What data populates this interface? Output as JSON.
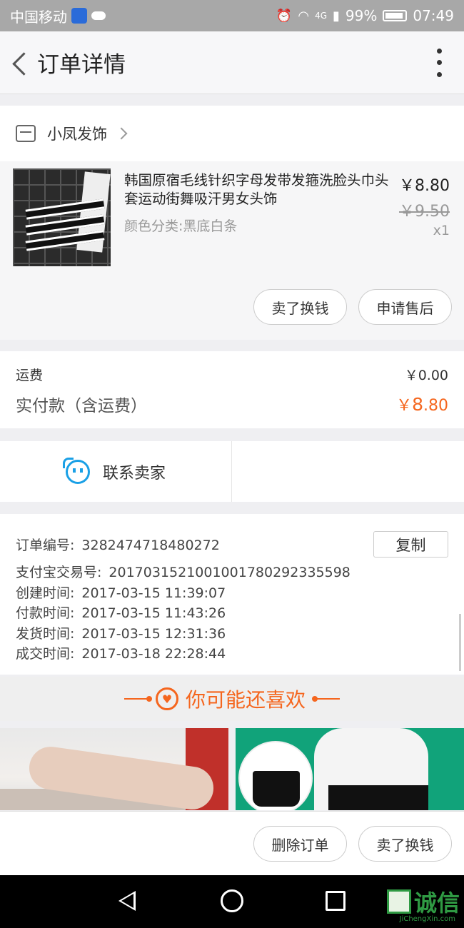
{
  "status_bar": {
    "carrier": "中国移动",
    "network": "4G",
    "battery": "99%",
    "time": "07:49"
  },
  "header": {
    "title": "订单详情"
  },
  "shop": {
    "name": "小凤发饰"
  },
  "product": {
    "title": "韩国原宿毛线针织字母发带发箍洗脸头巾头套运动街舞吸汗男女头饰",
    "spec": "颜色分类:黑底白条",
    "price": "￥8.80",
    "original_price": "￥9.50",
    "quantity": "x1",
    "actions": [
      "卖了换钱",
      "申请售后"
    ]
  },
  "fees": {
    "shipping_label": "运费",
    "shipping_value": "￥0.00",
    "total_label": "实付款（含运费）",
    "total_currency": "￥",
    "total_int": "8",
    "total_dec": ".80"
  },
  "contact": {
    "label": "联系卖家"
  },
  "order_info": {
    "copy_label": "复制",
    "rows": [
      {
        "label": "订单编号:",
        "value": "3282474718480272"
      },
      {
        "label": "支付宝交易号:",
        "value": "2017031521001001780292335598"
      },
      {
        "label": "创建时间:",
        "value": "2017-03-15 11:39:07"
      },
      {
        "label": "付款时间:",
        "value": "2017-03-15 11:43:26"
      },
      {
        "label": "发货时间:",
        "value": "2017-03-15 12:31:36"
      },
      {
        "label": "成交时间:",
        "value": "2017-03-18 22:28:44"
      }
    ]
  },
  "recommend": {
    "title": "你可能还喜欢"
  },
  "bottom_actions": [
    "删除订单",
    "卖了换钱"
  ],
  "watermark": {
    "text": "诚信",
    "sub": "JiChengXin.com"
  },
  "colors": {
    "accent_orange": "#f5661e",
    "contact_blue": "#1aa0e6"
  }
}
